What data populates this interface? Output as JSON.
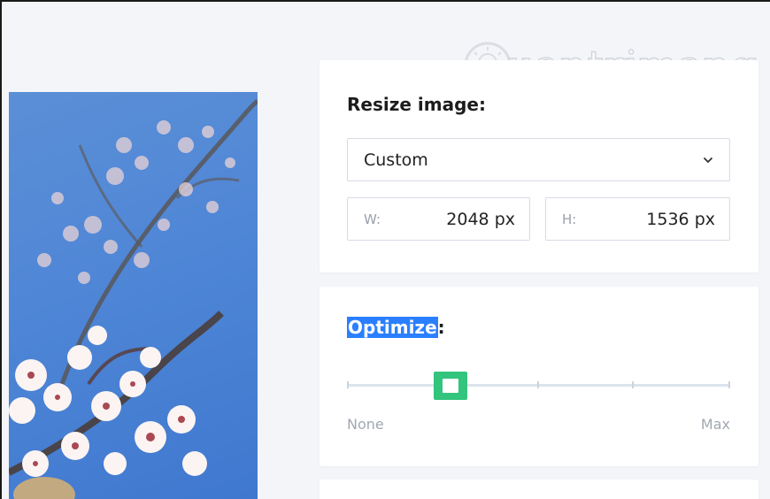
{
  "resize": {
    "title": "Resize image:",
    "preset": "Custom",
    "width_label": "W:",
    "width_value": "2048 px",
    "height_label": "H:",
    "height_value": "1536 px"
  },
  "optimize": {
    "title_highlighted": "Optimize",
    "title_suffix": ":",
    "min_label": "None",
    "max_label": "Max",
    "level_fraction": 0.27,
    "thumb_color": "#33c47d"
  },
  "watermark": {
    "text": "uantrimang"
  },
  "colors": {
    "page_bg": "#f4f5f9",
    "card_bg": "#ffffff",
    "highlight": "#2a7fff",
    "photo_sky": "#4f86d6"
  },
  "icons": [
    "chevron-down-icon",
    "lightbulb-logo-icon"
  ]
}
